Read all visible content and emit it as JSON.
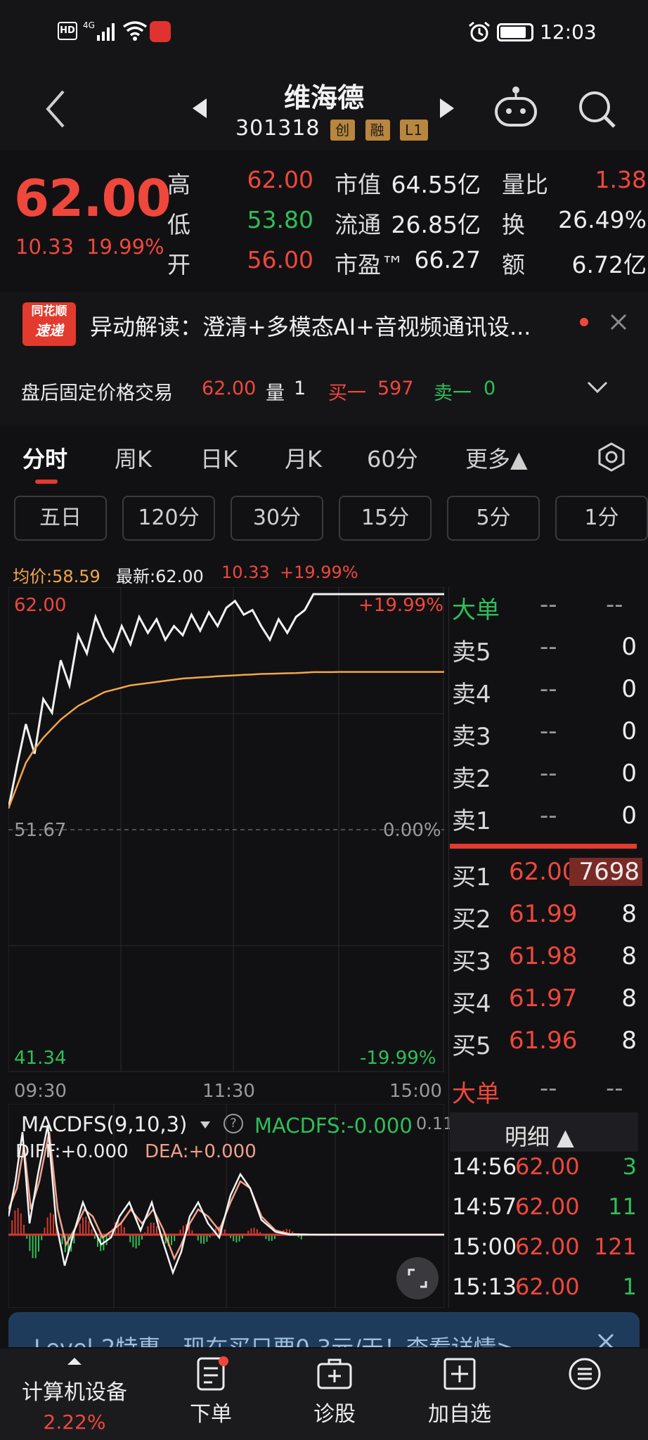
{
  "status_bar": {
    "left_icons": [
      "hd-icon",
      "4g-signal-icon",
      "wifi-icon",
      "app-notification-icon"
    ],
    "time": "12:03"
  },
  "header": {
    "name": "维海德",
    "code": "301318",
    "tags": [
      "创",
      "融",
      "L1"
    ]
  },
  "quote": {
    "price": "62.00",
    "change": "10.33",
    "change_pct": "19.99%",
    "high_label": "高",
    "high": "62.00",
    "low_label": "低",
    "low": "53.80",
    "open_label": "开",
    "open": "56.00",
    "mcap_label": "市值",
    "mcap": "64.55亿",
    "float_label": "流通",
    "float": "26.85亿",
    "pe_label": "市盈™",
    "pe": "66.27",
    "vol_ratio_label": "量比",
    "vol_ratio": "1.38",
    "turnover_label": "换",
    "turnover": "26.49%",
    "amount_label": "额",
    "amount": "6.72亿"
  },
  "news": {
    "logo_line1": "同花顺",
    "logo_line2": "速递",
    "text": "异动解读：澄清+多模态AI+音视频通讯设..."
  },
  "after_hours": {
    "label": "盘后固定价格交易",
    "price": "62.00",
    "vol_label": "量",
    "vol": "1",
    "buy1_label": "买一",
    "buy1": "597",
    "sell1_label": "卖一",
    "sell1": "0"
  },
  "tabs": [
    "分时",
    "周K",
    "日K",
    "月K",
    "60分",
    "更多▲"
  ],
  "sub_periods": [
    "五日",
    "120分",
    "30分",
    "15分",
    "5分",
    "1分"
  ],
  "chart_legend": {
    "avg_label": "均价:58.59",
    "latest_label": "最新:62.00",
    "change": "10.33",
    "change_pct": "+19.99%"
  },
  "chart_data": {
    "type": "line",
    "y_max": "62.00",
    "y_mid": "51.67",
    "y_min": "41.34",
    "pct_max": "+19.99%",
    "pct_mid": "0.00%",
    "pct_min": "-19.99%",
    "x_ticks": [
      "09:30",
      "11:30",
      "15:00"
    ],
    "ylim": [
      41.34,
      62.0
    ],
    "series": [
      {
        "values": [
          52.6,
          54.5,
          56.3,
          55.0,
          57.4,
          56.8,
          59.1,
          58.0,
          60.2,
          59.4,
          61.0,
          60.1,
          59.5,
          60.6,
          59.8,
          61.0,
          60.3,
          60.9,
          60.0,
          60.6,
          60.2,
          61.1,
          60.4,
          61.2,
          60.6,
          61.4,
          61.7,
          61.1,
          61.3,
          60.6,
          60.0,
          60.9,
          60.3,
          61.0,
          61.3,
          62.0,
          62.0,
          62.0,
          62.0,
          62.0,
          62.0,
          62.0,
          62.0,
          62.0,
          62.0,
          62.0,
          62.0,
          62.0,
          62.0,
          62.0,
          62.0
        ]
      },
      {
        "values": [
          52.6,
          53.6,
          54.6,
          55.2,
          55.7,
          56.1,
          56.5,
          56.8,
          57.1,
          57.3,
          57.5,
          57.7,
          57.8,
          57.9,
          58.0,
          58.05,
          58.1,
          58.15,
          58.2,
          58.25,
          58.3,
          58.32,
          58.35,
          58.37,
          58.4,
          58.42,
          58.44,
          58.46,
          58.48,
          58.5,
          58.51,
          58.52,
          58.53,
          58.54,
          58.56,
          58.58,
          58.58,
          58.58,
          58.59,
          58.59,
          58.59,
          58.59,
          58.59,
          58.59,
          58.59,
          58.59,
          58.59,
          58.59,
          58.59,
          58.59,
          58.59
        ]
      }
    ]
  },
  "macd": {
    "title": "MACDFS(9,10,3)",
    "value_label": "MACDFS:-0.000",
    "diff_label": "DIFF:+0.000",
    "dea_label": "DEA:+0.000",
    "max_label": "0.11"
  },
  "order_book": {
    "big_order_label": "大单",
    "big_order_v1": "--",
    "big_order_v2": "--",
    "sells": [
      {
        "label": "卖5",
        "price": "--",
        "vol": "0"
      },
      {
        "label": "卖4",
        "price": "--",
        "vol": "0"
      },
      {
        "label": "卖3",
        "price": "--",
        "vol": "0"
      },
      {
        "label": "卖2",
        "price": "--",
        "vol": "0"
      },
      {
        "label": "卖1",
        "price": "--",
        "vol": "0"
      }
    ],
    "buys": [
      {
        "label": "买1",
        "price": "62.00",
        "vol": "7698"
      },
      {
        "label": "买2",
        "price": "61.99",
        "vol": "8"
      },
      {
        "label": "买3",
        "price": "61.98",
        "vol": "8"
      },
      {
        "label": "买4",
        "price": "61.97",
        "vol": "8"
      },
      {
        "label": "买5",
        "price": "61.96",
        "vol": "8"
      }
    ],
    "big_order2_label": "大单",
    "big_order2_v1": "--",
    "big_order2_v2": "--",
    "detail_label": "明细 ▲",
    "trades": [
      {
        "time": "14:56",
        "price": "62.00",
        "vol": "3",
        "vol_color": "#2fbf57"
      },
      {
        "time": "14:57",
        "price": "62.00",
        "vol": "11",
        "vol_color": "#2fbf57"
      },
      {
        "time": "15:00",
        "price": "62.00",
        "vol": "121",
        "vol_color": "#f0473c"
      },
      {
        "time": "15:13",
        "price": "62.00",
        "vol": "1",
        "vol_color": "#2fbf57"
      }
    ]
  },
  "banner": {
    "text": "Level-2特惠，现在买只要0.3元/天！查看详情>"
  },
  "nav": {
    "sector_label": "计算机设备",
    "sector_change": "2.22%",
    "order_label": "下单",
    "diagnose_label": "诊股",
    "add_watch_label": "加自选"
  }
}
